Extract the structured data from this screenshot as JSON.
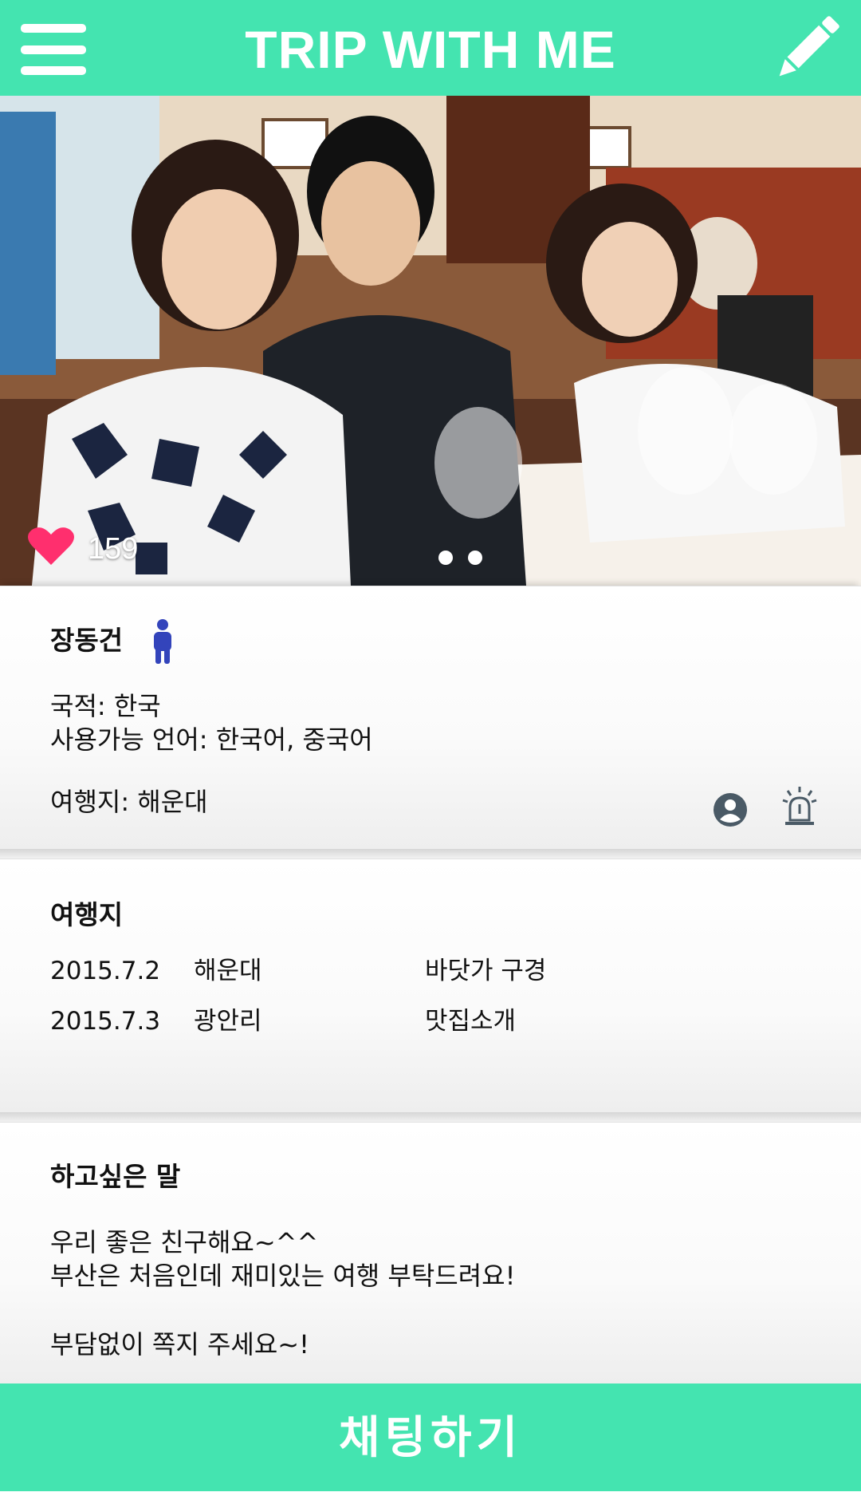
{
  "header": {
    "title": "TRIP WITH ME",
    "menu_icon": "hamburger-menu-icon",
    "edit_icon": "pencil-icon"
  },
  "photo": {
    "likes": "159",
    "heart_icon": "heart-icon",
    "slide_count": 2
  },
  "profile": {
    "name": "장동건",
    "gender_icon": "male-person-icon",
    "nationality": "국적: 한국",
    "languages": "사용가능 언어: 한국어, 중국어",
    "destination": "여행지: 해운대",
    "profile_icon": "user-circle-icon",
    "report_icon": "siren-icon"
  },
  "trips": {
    "title": "여행지",
    "rows": [
      {
        "date": "2015.7.2",
        "place": "해운대",
        "activity": "바닷가 구경"
      },
      {
        "date": "2015.7.3",
        "place": "광안리",
        "activity": "맛집소개"
      }
    ]
  },
  "message": {
    "title": "하고싶은 말",
    "line1": "우리 좋은 친구해요~^^",
    "line2": "부산은 처음인데 재미있는 여행 부탁드려요!",
    "line3": "부담없이 쪽지 주세요~!"
  },
  "chat_button": {
    "label": "채팅하기"
  },
  "colors": {
    "accent": "#44e4b0",
    "heart": "#ff2f6e",
    "male_icon": "#3344bb",
    "icon_gray": "#4a5a66"
  }
}
